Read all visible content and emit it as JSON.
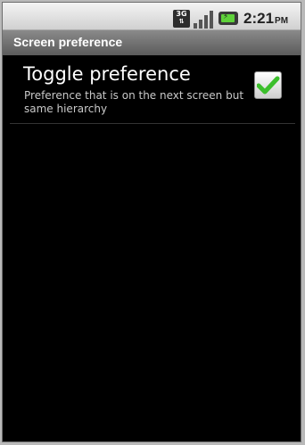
{
  "status_bar": {
    "network_label": "3G",
    "network_icon": "3g-data-icon",
    "signal_icon": "signal-strength-icon",
    "battery_icon": "battery-charging-icon",
    "time": "2:21",
    "ampm": "PM"
  },
  "title_bar": {
    "title": "Screen preference"
  },
  "preference": {
    "title": "Toggle preference",
    "summary": "Preference that is on the next screen but same hierarchy",
    "checked": true,
    "check_color": "#3cbf2c"
  }
}
